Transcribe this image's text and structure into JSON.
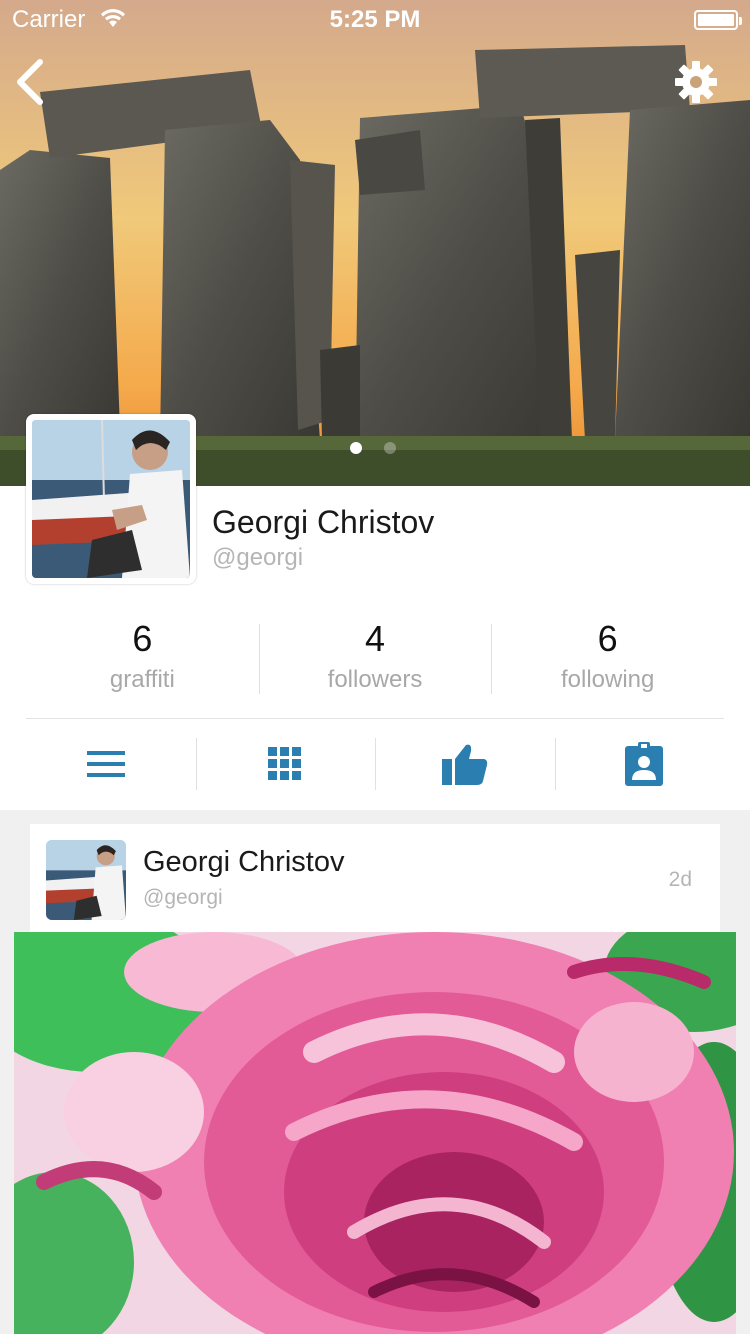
{
  "status_bar": {
    "carrier": "Carrier",
    "time": "5:25 PM"
  },
  "cover": {
    "page_dots": 2,
    "active_dot": 1
  },
  "profile": {
    "name": "Georgi Christov",
    "handle": "@georgi"
  },
  "stats": [
    {
      "count": "6",
      "label": "graffiti"
    },
    {
      "count": "4",
      "label": "followers"
    },
    {
      "count": "6",
      "label": "following"
    }
  ],
  "tabs": [
    {
      "icon": "list-icon"
    },
    {
      "icon": "grid-icon"
    },
    {
      "icon": "thumbs-up-icon"
    },
    {
      "icon": "contact-badge-icon"
    }
  ],
  "post": {
    "author_name": "Georgi Christov",
    "author_handle": "@georgi",
    "time_ago": "2d"
  },
  "colors": {
    "accent": "#2a7fb0",
    "muted_text": "#a8a8a8"
  }
}
